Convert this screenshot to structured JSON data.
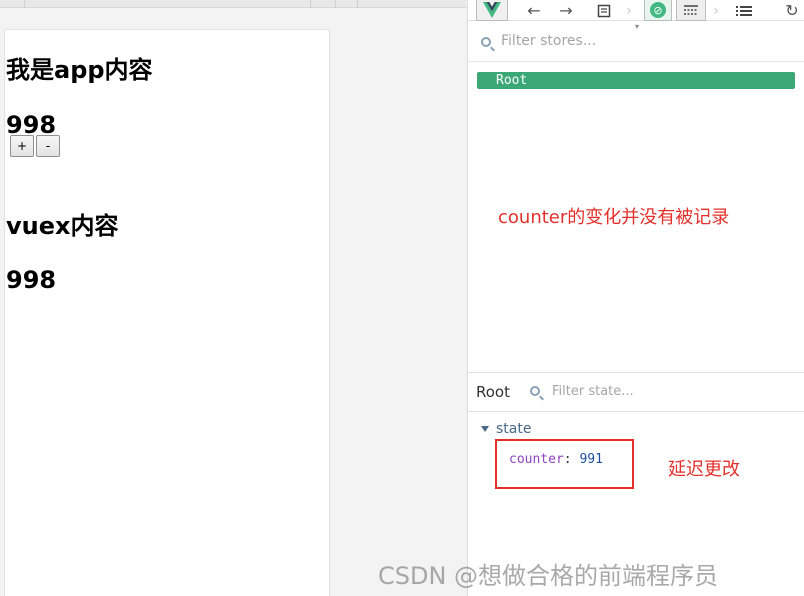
{
  "app": {
    "title_line": "我是app内容",
    "counter_value": "998",
    "buttons": {
      "increment": "+",
      "decrement": "-"
    },
    "vuex_title": "vuex内容",
    "vuex_counter_value": "998"
  },
  "devtools": {
    "toolbar_icons": [
      "vue-logo-icon",
      "back-arrow-icon",
      "forward-arrow-icon",
      "components-icon",
      "vuex-icon",
      "events-icon",
      "list-icon",
      "refresh-icon"
    ],
    "filter_stores_placeholder": "Filter stores...",
    "root_label": "Root",
    "state_panel_title": "Root",
    "filter_state_placeholder": "Filter state...",
    "state_section": "state",
    "state_key": "counter",
    "state_value": "991",
    "accent_color": "#3ba776"
  },
  "annotations": {
    "note1": "counter的变化并没有被记录",
    "note2": "延迟更改",
    "annotation_color": "#e3302b"
  },
  "watermark": "CSDN @想做合格的前端程序员"
}
